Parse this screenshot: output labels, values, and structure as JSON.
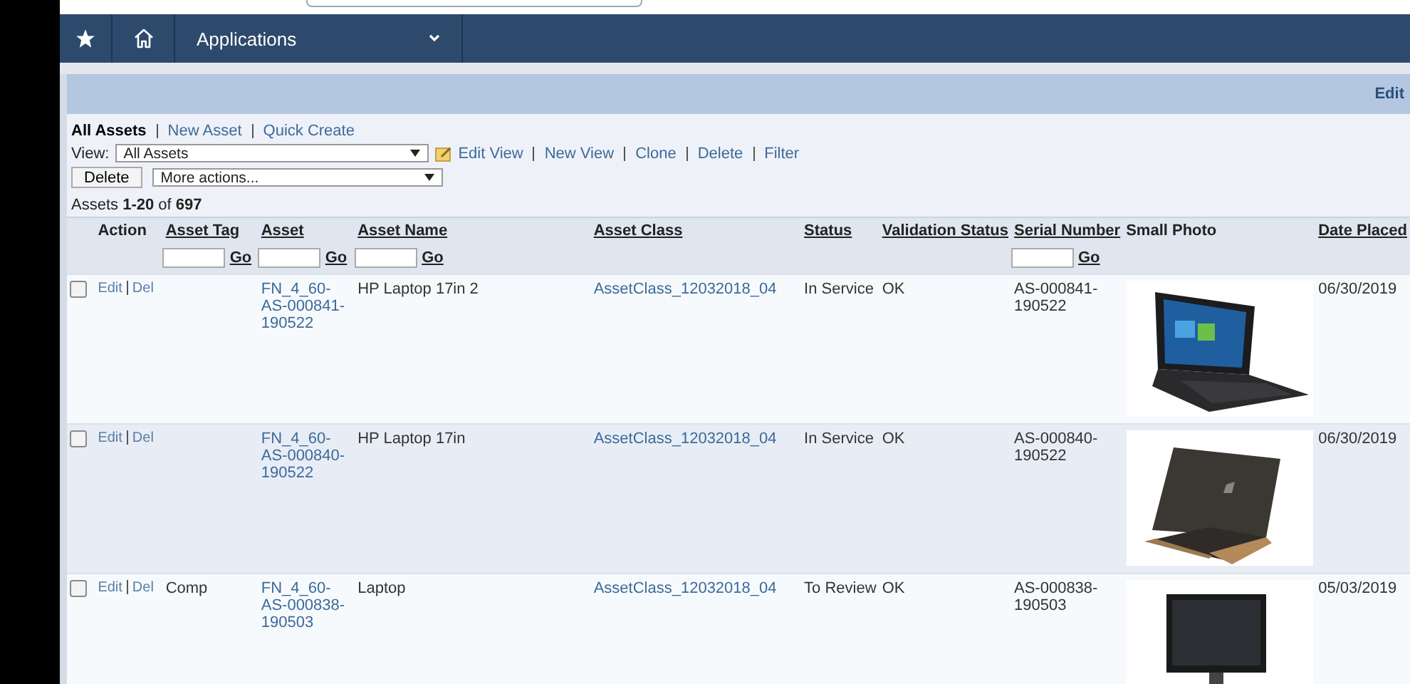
{
  "nav": {
    "menu_label": "Applications"
  },
  "header_band": {
    "link": "Edit"
  },
  "list_tabs": [
    {
      "label": "All Assets",
      "selected": true
    },
    {
      "label": "New Asset",
      "selected": false
    },
    {
      "label": "Quick Create",
      "selected": false
    }
  ],
  "view_select": {
    "label": "View:",
    "value": "All Assets"
  },
  "view_links": [
    "Edit View",
    "New View",
    "Clone",
    "Delete",
    "Filter"
  ],
  "delete_button": "Delete",
  "actions_select": {
    "value": "More actions..."
  },
  "record_count": "Assets **1-20** of **697**",
  "table": {
    "columns": [
      {
        "label": "Action",
        "sortable": false
      },
      {
        "label": "Asset Tag",
        "sortable": true,
        "filter_go": "Go"
      },
      {
        "label": "Asset",
        "sortable": true,
        "filter_go": "Go"
      },
      {
        "label": "Asset Name",
        "sortable": true,
        "filter_go": "Go"
      },
      {
        "label": "Asset Class",
        "sortable": true
      },
      {
        "label": "Status",
        "sortable": true
      },
      {
        "label": "Validation Status",
        "sortable": true
      },
      {
        "label": "Serial Number",
        "sortable": true,
        "filter_go": "Go"
      },
      {
        "label": "Small Photo",
        "sortable": false
      },
      {
        "label": "Date Placed",
        "sortable": true
      }
    ],
    "rows": [
      {
        "checked": false,
        "actions": [
          "Edit",
          "Del"
        ],
        "asset": "FN_4_60-AS-000841-190522",
        "asset_name": "HP Laptop 17in 2",
        "asset_class": "AssetClass_12032018_04",
        "status": "In Service",
        "validation_status": "OK",
        "serial_number": "AS-000841-190522",
        "small_photo": {
          "kind": "picture"
        },
        "date_placed": "06/30/2019"
      },
      {
        "checked": false,
        "actions": [
          "Edit",
          "Del"
        ],
        "asset": "FN_4_60-AS-000840-190522",
        "asset_name": "HP Laptop 17in",
        "asset_class": "AssetClass_12032018_04",
        "status": "In Service",
        "validation_status": "OK",
        "serial_number": "AS-000840-190522",
        "small_photo": {
          "kind": "picture"
        },
        "date_placed": "06/30/2019"
      },
      {
        "checked": false,
        "actions": [
          "Edit",
          "Del"
        ],
        "asset_tag": "Comp",
        "asset": "FN_4_60-AS-000838-190503",
        "asset_name": "Laptop",
        "asset_class": "AssetClass_12032018_04",
        "status": "To Review",
        "validation_status": "OK",
        "serial_number": "AS-000838-190503",
        "small_photo": {
          "kind": "picture"
        },
        "date_placed": "05/03/2019"
      }
    ]
  }
}
